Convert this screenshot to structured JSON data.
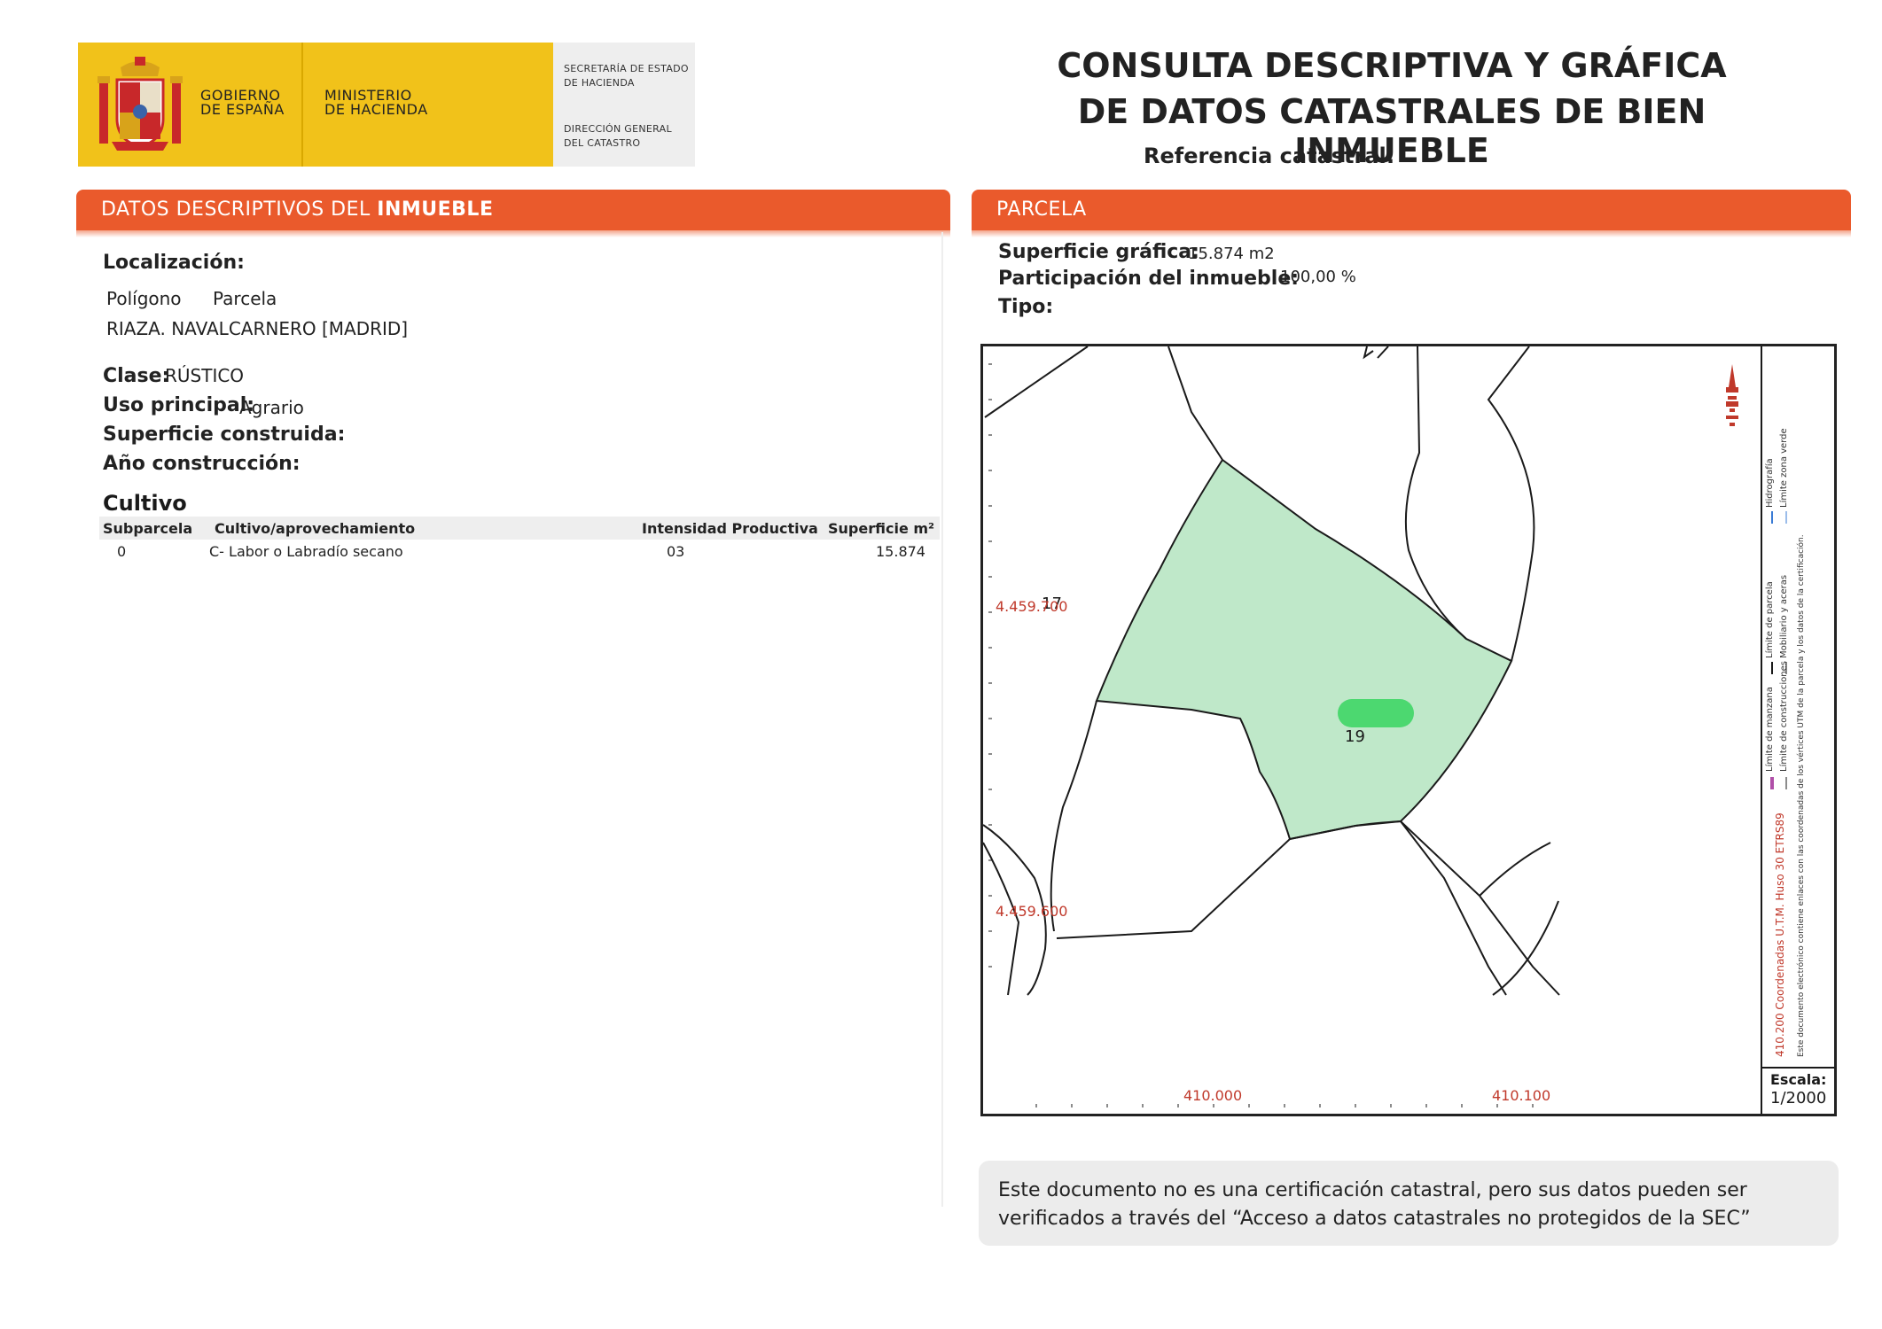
{
  "header": {
    "gobierno": [
      "GOBIERNO",
      "DE ESPAÑA"
    ],
    "ministerio": [
      "MINISTERIO",
      "DE HACIENDA"
    ],
    "secretaria": [
      "SECRETARÍA DE ESTADO",
      "DE HACIENDA"
    ],
    "direccion": [
      "DIRECCIÓN GENERAL",
      "DEL CATASTRO"
    ],
    "title_line1": "CONSULTA DESCRIPTIVA Y GRÁFICA",
    "title_line2": "DE DATOS CATASTRALES DE BIEN INMUEBLE",
    "referencia_label": "Referencia catastral:"
  },
  "descriptivos": {
    "bar_title_plain": "DATOS DESCRIPTIVOS DEL ",
    "bar_title_bold": "INMUEBLE",
    "localizacion_label": "Localización:",
    "poligono_label": "Polígono",
    "parcela_label": "Parcela",
    "direccion": "RIAZA. NAVALCARNERO [MADRID]",
    "clase_label": "Clase:",
    "clase_value": "RÚSTICO",
    "uso_label": "Uso principal:",
    "uso_value": "Agrario",
    "superficie_construida_label": "Superficie construida:",
    "anio_label": "Año construcción:",
    "cultivo_label": "Cultivo",
    "table": {
      "headers": [
        "Subparcela",
        "Cultivo/aprovechamiento",
        "Intensidad Productiva",
        "Superficie m²"
      ],
      "rows": [
        [
          "0",
          "C- Labor o Labradío secano",
          "03",
          "15.874"
        ]
      ]
    }
  },
  "parcela": {
    "bar_title": "PARCELA",
    "superficie_label": "Superficie gráfica:",
    "superficie_value": "15.874 m2",
    "participacion_label": "Participación del inmueble:",
    "participacion_value": "100,00 %",
    "tipo_label": "Tipo:"
  },
  "map": {
    "parcel_number": "19",
    "neighbor_number": "17",
    "y_labels": [
      "4.459.700",
      "4.459.600"
    ],
    "x_labels": [
      "410.000",
      "410.100"
    ],
    "side_text_red": "410.200 Coordenadas U.T.M. Huso 30 ETRS89",
    "side_text_note": "Este documento electrónico contiene enlaces con las coordenadas de los vértices UTM de la parcela y los datos de la certificación.",
    "legend": [
      "Límite de manzana",
      "Límite de parcela",
      "Hidrografía",
      "Límite de construcciones",
      "Mobiliario y aceras",
      "Límite zona verde"
    ],
    "escala_label": "Escala:",
    "escala_value": "1/2000",
    "parcel_color": "#bfe8c9",
    "label_color": "#c0392b"
  },
  "footer_note": "Este documento no es una certificación catastral, pero sus datos pueden ser verificados a través del “Acceso a datos catastrales no protegidos de la SEC”",
  "colors": {
    "accent": "#ea5a2c",
    "logo_yellow": "#f1c21a"
  }
}
